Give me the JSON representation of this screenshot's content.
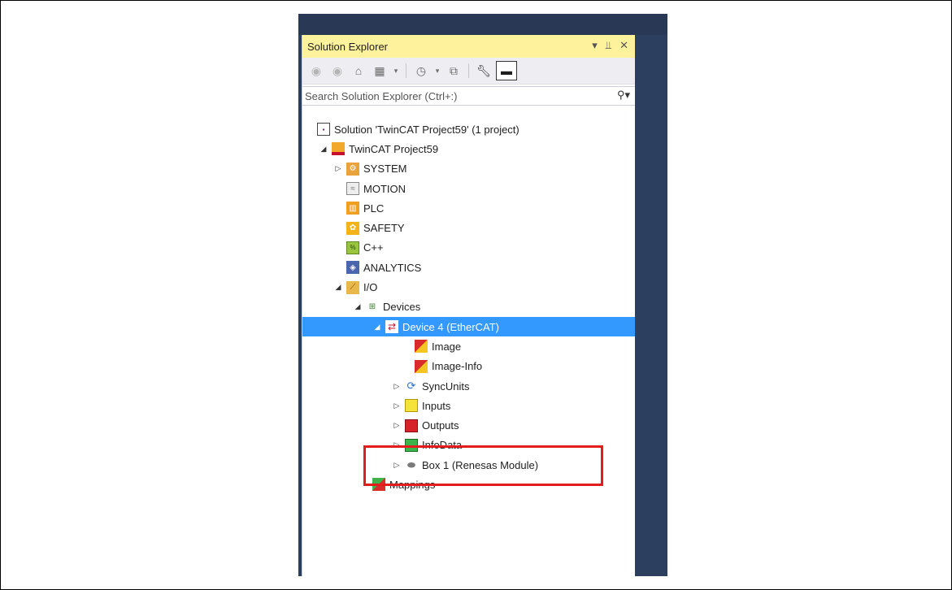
{
  "window": {
    "title": "Solution Explorer",
    "controls": [
      "▾",
      "⫫",
      "✕"
    ]
  },
  "toolbar": {
    "buttons": [
      "back",
      "forward",
      "home",
      "switch-views",
      "history",
      "collapse-all",
      "properties",
      "pin"
    ]
  },
  "search": {
    "placeholder": "Search Solution Explorer (Ctrl+:)"
  },
  "tree": {
    "items": [
      {
        "label": "Solution 'TwinCAT Project59' (1 project)",
        "expander": ""
      },
      {
        "label": "TwinCAT Project59",
        "expander": "◢"
      },
      {
        "label": "SYSTEM",
        "expander": "▷"
      },
      {
        "label": "MOTION",
        "expander": ""
      },
      {
        "label": "PLC",
        "expander": ""
      },
      {
        "label": "SAFETY",
        "expander": ""
      },
      {
        "label": "C++",
        "expander": ""
      },
      {
        "label": "ANALYTICS",
        "expander": ""
      },
      {
        "label": "I/O",
        "expander": "◢"
      },
      {
        "label": "Devices",
        "expander": "◢"
      },
      {
        "label": "Device 4 (EtherCAT)",
        "expander": "◢"
      },
      {
        "label": "Image",
        "expander": ""
      },
      {
        "label": "Image-Info",
        "expander": ""
      },
      {
        "label": "SyncUnits",
        "expander": "▷"
      },
      {
        "label": "Inputs",
        "expander": "▷"
      },
      {
        "label": "Outputs",
        "expander": "▷"
      },
      {
        "label": "InfoData",
        "expander": "▷"
      },
      {
        "label": "Box 1 (Renesas Module)",
        "expander": "▷"
      },
      {
        "label": "Mappings",
        "expander": ""
      }
    ]
  },
  "colors": {
    "title_bar": "#fff29d",
    "selection": "#3399ff",
    "highlight_box": "#e41c1c",
    "ide_background": "#2d3f5f"
  }
}
